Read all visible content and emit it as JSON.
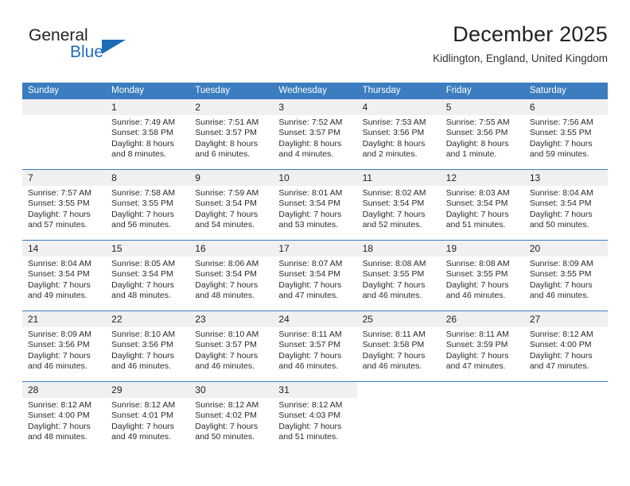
{
  "brand": {
    "name_top": "General",
    "name_bottom": "Blue",
    "accent_color": "#1b6cb5",
    "logo_icon": "triangle-logo-icon"
  },
  "header": {
    "title": "December 2025",
    "location": "Kidlington, England, United Kingdom"
  },
  "theme": {
    "header_bg": "#3b7dbf",
    "daynum_bg": "#f0f0f0",
    "grid_line": "#3b7dbf",
    "text": "#2b2b2b"
  },
  "calendar": {
    "weekday_headers": [
      "Sunday",
      "Monday",
      "Tuesday",
      "Wednesday",
      "Thursday",
      "Friday",
      "Saturday"
    ],
    "weeks": [
      [
        {
          "day": "",
          "empty": true,
          "sunrise": "",
          "sunset": "",
          "daylight_1": "",
          "daylight_2": ""
        },
        {
          "day": "1",
          "sunrise": "Sunrise: 7:49 AM",
          "sunset": "Sunset: 3:58 PM",
          "daylight_1": "Daylight: 8 hours",
          "daylight_2": "and 8 minutes."
        },
        {
          "day": "2",
          "sunrise": "Sunrise: 7:51 AM",
          "sunset": "Sunset: 3:57 PM",
          "daylight_1": "Daylight: 8 hours",
          "daylight_2": "and 6 minutes."
        },
        {
          "day": "3",
          "sunrise": "Sunrise: 7:52 AM",
          "sunset": "Sunset: 3:57 PM",
          "daylight_1": "Daylight: 8 hours",
          "daylight_2": "and 4 minutes."
        },
        {
          "day": "4",
          "sunrise": "Sunrise: 7:53 AM",
          "sunset": "Sunset: 3:56 PM",
          "daylight_1": "Daylight: 8 hours",
          "daylight_2": "and 2 minutes."
        },
        {
          "day": "5",
          "sunrise": "Sunrise: 7:55 AM",
          "sunset": "Sunset: 3:56 PM",
          "daylight_1": "Daylight: 8 hours",
          "daylight_2": "and 1 minute."
        },
        {
          "day": "6",
          "sunrise": "Sunrise: 7:56 AM",
          "sunset": "Sunset: 3:55 PM",
          "daylight_1": "Daylight: 7 hours",
          "daylight_2": "and 59 minutes."
        }
      ],
      [
        {
          "day": "7",
          "sunrise": "Sunrise: 7:57 AM",
          "sunset": "Sunset: 3:55 PM",
          "daylight_1": "Daylight: 7 hours",
          "daylight_2": "and 57 minutes."
        },
        {
          "day": "8",
          "sunrise": "Sunrise: 7:58 AM",
          "sunset": "Sunset: 3:55 PM",
          "daylight_1": "Daylight: 7 hours",
          "daylight_2": "and 56 minutes."
        },
        {
          "day": "9",
          "sunrise": "Sunrise: 7:59 AM",
          "sunset": "Sunset: 3:54 PM",
          "daylight_1": "Daylight: 7 hours",
          "daylight_2": "and 54 minutes."
        },
        {
          "day": "10",
          "sunrise": "Sunrise: 8:01 AM",
          "sunset": "Sunset: 3:54 PM",
          "daylight_1": "Daylight: 7 hours",
          "daylight_2": "and 53 minutes."
        },
        {
          "day": "11",
          "sunrise": "Sunrise: 8:02 AM",
          "sunset": "Sunset: 3:54 PM",
          "daylight_1": "Daylight: 7 hours",
          "daylight_2": "and 52 minutes."
        },
        {
          "day": "12",
          "sunrise": "Sunrise: 8:03 AM",
          "sunset": "Sunset: 3:54 PM",
          "daylight_1": "Daylight: 7 hours",
          "daylight_2": "and 51 minutes."
        },
        {
          "day": "13",
          "sunrise": "Sunrise: 8:04 AM",
          "sunset": "Sunset: 3:54 PM",
          "daylight_1": "Daylight: 7 hours",
          "daylight_2": "and 50 minutes."
        }
      ],
      [
        {
          "day": "14",
          "sunrise": "Sunrise: 8:04 AM",
          "sunset": "Sunset: 3:54 PM",
          "daylight_1": "Daylight: 7 hours",
          "daylight_2": "and 49 minutes."
        },
        {
          "day": "15",
          "sunrise": "Sunrise: 8:05 AM",
          "sunset": "Sunset: 3:54 PM",
          "daylight_1": "Daylight: 7 hours",
          "daylight_2": "and 48 minutes."
        },
        {
          "day": "16",
          "sunrise": "Sunrise: 8:06 AM",
          "sunset": "Sunset: 3:54 PM",
          "daylight_1": "Daylight: 7 hours",
          "daylight_2": "and 48 minutes."
        },
        {
          "day": "17",
          "sunrise": "Sunrise: 8:07 AM",
          "sunset": "Sunset: 3:54 PM",
          "daylight_1": "Daylight: 7 hours",
          "daylight_2": "and 47 minutes."
        },
        {
          "day": "18",
          "sunrise": "Sunrise: 8:08 AM",
          "sunset": "Sunset: 3:55 PM",
          "daylight_1": "Daylight: 7 hours",
          "daylight_2": "and 46 minutes."
        },
        {
          "day": "19",
          "sunrise": "Sunrise: 8:08 AM",
          "sunset": "Sunset: 3:55 PM",
          "daylight_1": "Daylight: 7 hours",
          "daylight_2": "and 46 minutes."
        },
        {
          "day": "20",
          "sunrise": "Sunrise: 8:09 AM",
          "sunset": "Sunset: 3:55 PM",
          "daylight_1": "Daylight: 7 hours",
          "daylight_2": "and 46 minutes."
        }
      ],
      [
        {
          "day": "21",
          "sunrise": "Sunrise: 8:09 AM",
          "sunset": "Sunset: 3:56 PM",
          "daylight_1": "Daylight: 7 hours",
          "daylight_2": "and 46 minutes."
        },
        {
          "day": "22",
          "sunrise": "Sunrise: 8:10 AM",
          "sunset": "Sunset: 3:56 PM",
          "daylight_1": "Daylight: 7 hours",
          "daylight_2": "and 46 minutes."
        },
        {
          "day": "23",
          "sunrise": "Sunrise: 8:10 AM",
          "sunset": "Sunset: 3:57 PM",
          "daylight_1": "Daylight: 7 hours",
          "daylight_2": "and 46 minutes."
        },
        {
          "day": "24",
          "sunrise": "Sunrise: 8:11 AM",
          "sunset": "Sunset: 3:57 PM",
          "daylight_1": "Daylight: 7 hours",
          "daylight_2": "and 46 minutes."
        },
        {
          "day": "25",
          "sunrise": "Sunrise: 8:11 AM",
          "sunset": "Sunset: 3:58 PM",
          "daylight_1": "Daylight: 7 hours",
          "daylight_2": "and 46 minutes."
        },
        {
          "day": "26",
          "sunrise": "Sunrise: 8:11 AM",
          "sunset": "Sunset: 3:59 PM",
          "daylight_1": "Daylight: 7 hours",
          "daylight_2": "and 47 minutes."
        },
        {
          "day": "27",
          "sunrise": "Sunrise: 8:12 AM",
          "sunset": "Sunset: 4:00 PM",
          "daylight_1": "Daylight: 7 hours",
          "daylight_2": "and 47 minutes."
        }
      ],
      [
        {
          "day": "28",
          "sunrise": "Sunrise: 8:12 AM",
          "sunset": "Sunset: 4:00 PM",
          "daylight_1": "Daylight: 7 hours",
          "daylight_2": "and 48 minutes."
        },
        {
          "day": "29",
          "sunrise": "Sunrise: 8:12 AM",
          "sunset": "Sunset: 4:01 PM",
          "daylight_1": "Daylight: 7 hours",
          "daylight_2": "and 49 minutes."
        },
        {
          "day": "30",
          "sunrise": "Sunrise: 8:12 AM",
          "sunset": "Sunset: 4:02 PM",
          "daylight_1": "Daylight: 7 hours",
          "daylight_2": "and 50 minutes."
        },
        {
          "day": "31",
          "sunrise": "Sunrise: 8:12 AM",
          "sunset": "Sunset: 4:03 PM",
          "daylight_1": "Daylight: 7 hours",
          "daylight_2": "and 51 minutes."
        },
        {
          "day": "",
          "empty": true,
          "blank": true,
          "sunrise": "",
          "sunset": "",
          "daylight_1": "",
          "daylight_2": ""
        },
        {
          "day": "",
          "empty": true,
          "blank": true,
          "sunrise": "",
          "sunset": "",
          "daylight_1": "",
          "daylight_2": ""
        },
        {
          "day": "",
          "empty": true,
          "blank": true,
          "sunrise": "",
          "sunset": "",
          "daylight_1": "",
          "daylight_2": ""
        }
      ]
    ]
  }
}
